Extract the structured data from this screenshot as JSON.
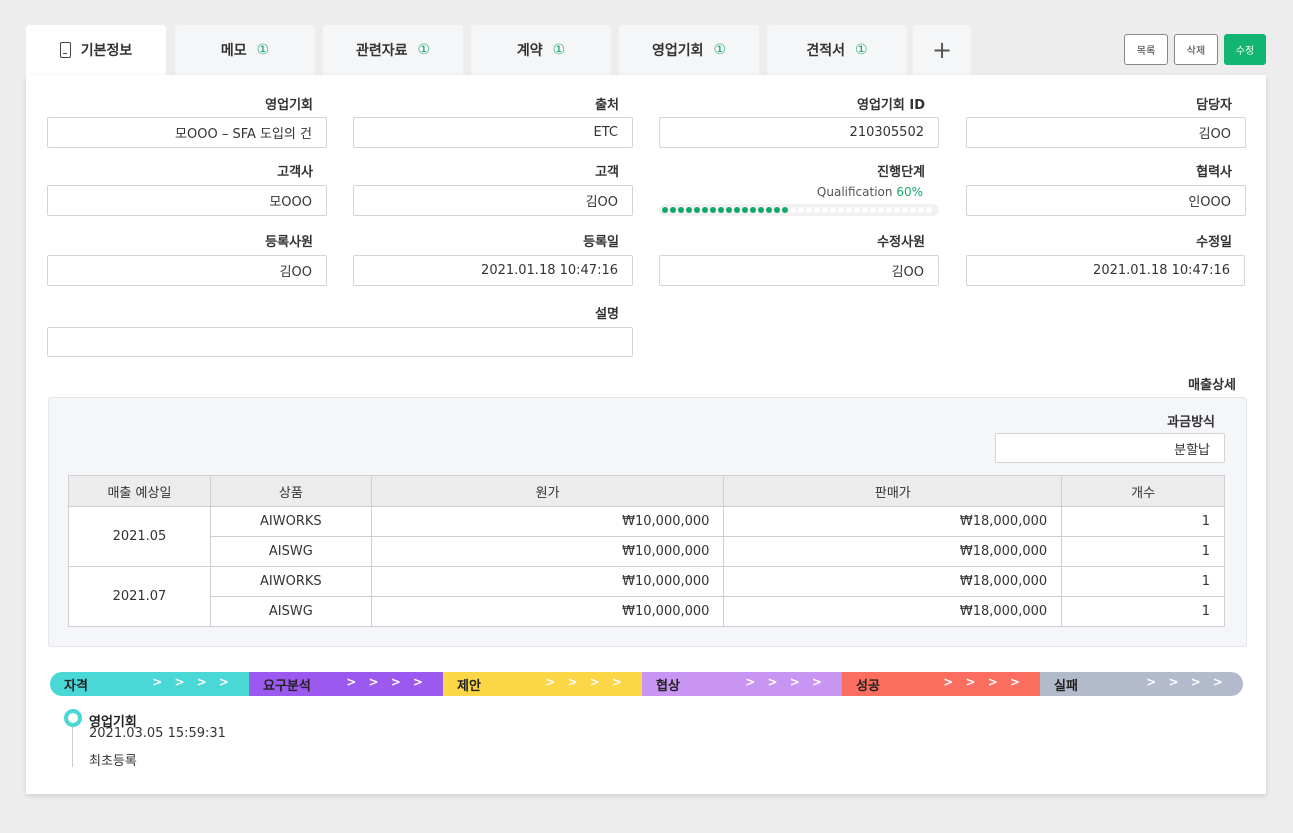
{
  "tabs": [
    {
      "label": "기본정보",
      "badge": ""
    },
    {
      "label": "메모",
      "badge": "①"
    },
    {
      "label": "관련자료",
      "badge": "①"
    },
    {
      "label": "계약",
      "badge": "①"
    },
    {
      "label": "영업기회",
      "badge": "①"
    },
    {
      "label": "견적서",
      "badge": "①"
    }
  ],
  "add_tab": "+",
  "buttons": {
    "list": "목록",
    "delete": "삭제",
    "edit": "수정"
  },
  "fields": {
    "opportunity": {
      "label": "영업기회",
      "value": "모OOO – SFA 도입의 건"
    },
    "source": {
      "label": "출처",
      "value": "ETC"
    },
    "opportunity_id": {
      "label": "영업기회 ID",
      "value": "210305502"
    },
    "owner": {
      "label": "담당자",
      "value": "김OO"
    },
    "customer_company": {
      "label": "고객사",
      "value": "모OOO"
    },
    "customer": {
      "label": "고객",
      "value": "김OO"
    },
    "stage": {
      "label": "진행단계",
      "name": "Qualification",
      "percent": "60%",
      "fraction": 0.6
    },
    "partner": {
      "label": "협력사",
      "value": "인OOO"
    },
    "registered_by": {
      "label": "등록사원",
      "value": "김OO"
    },
    "registered_at": {
      "label": "등록일",
      "value": "2021.01.18  10:47:16"
    },
    "modified_by": {
      "label": "수정사원",
      "value": "김OO"
    },
    "modified_at": {
      "label": "수정일",
      "value": "2021.01.18  10:47:16"
    },
    "description": {
      "label": "설명",
      "value": ""
    }
  },
  "sales_detail": {
    "title": "매출상세",
    "billing_label": "과금방식",
    "billing_value": "분할납",
    "columns": [
      "매출 예상일",
      "상품",
      "원가",
      "판매가",
      "개수"
    ],
    "groups": [
      {
        "date": "2021.05",
        "rows": [
          {
            "product": "AIWORKS",
            "cost": "₩10,000,000",
            "price": "₩18,000,000",
            "qty": "1"
          },
          {
            "product": "AISWG",
            "cost": "₩10,000,000",
            "price": "₩18,000,000",
            "qty": "1"
          }
        ]
      },
      {
        "date": "2021.07",
        "rows": [
          {
            "product": "AIWORKS",
            "cost": "₩10,000,000",
            "price": "₩18,000,000",
            "qty": "1"
          },
          {
            "product": "AISWG",
            "cost": "₩10,000,000",
            "price": "₩18,000,000",
            "qty": "1"
          }
        ]
      }
    ]
  },
  "pipeline": [
    {
      "label": "자격",
      "color": "#4ad8d6"
    },
    {
      "label": "요구분석",
      "color": "#9b59f0"
    },
    {
      "label": "제안",
      "color": "#fbd646"
    },
    {
      "label": "협상",
      "color": "#c896f2"
    },
    {
      "label": "성공",
      "color": "#fb6d5e"
    },
    {
      "label": "실패",
      "color": "#b3bacb"
    }
  ],
  "pipeline_arrows": "> > > >",
  "timeline": {
    "title": "영업기회",
    "time": "2021.03.05  15:59:31",
    "desc": "최초등록"
  }
}
